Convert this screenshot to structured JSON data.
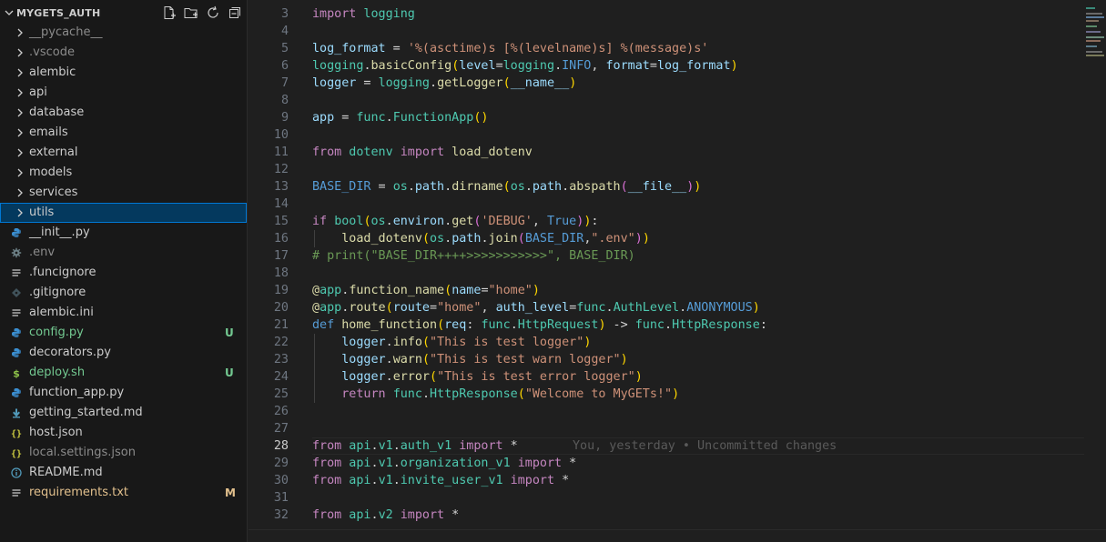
{
  "explorer": {
    "root_title": "MYGETS_AUTH",
    "header_icons": [
      "new-file-icon",
      "new-folder-icon",
      "refresh-icon",
      "collapse-all-icon"
    ],
    "folders": [
      {
        "label": "__pycache__",
        "dim": true
      },
      {
        "label": ".vscode",
        "dim": true
      },
      {
        "label": "alembic"
      },
      {
        "label": "api"
      },
      {
        "label": "database"
      },
      {
        "label": "emails"
      },
      {
        "label": "external"
      },
      {
        "label": "models"
      },
      {
        "label": "services"
      },
      {
        "label": "utils",
        "selected": true
      }
    ],
    "files": [
      {
        "label": "__init__.py",
        "icon": "python-icon"
      },
      {
        "label": ".env",
        "icon": "gear-icon",
        "dim": true
      },
      {
        "label": ".funcignore",
        "icon": "lines-icon"
      },
      {
        "label": ".gitignore",
        "icon": "git-icon"
      },
      {
        "label": "alembic.ini",
        "icon": "lines-icon"
      },
      {
        "label": "config.py",
        "icon": "python-icon",
        "status": "U"
      },
      {
        "label": "decorators.py",
        "icon": "python-icon"
      },
      {
        "label": "deploy.sh",
        "icon": "shell-icon",
        "status": "U"
      },
      {
        "label": "function_app.py",
        "icon": "python-icon"
      },
      {
        "label": "getting_started.md",
        "icon": "markdown-icon"
      },
      {
        "label": "host.json",
        "icon": "json-icon"
      },
      {
        "label": "local.settings.json",
        "icon": "json-icon",
        "dim": true
      },
      {
        "label": "README.md",
        "icon": "info-icon"
      },
      {
        "label": "requirements.txt",
        "icon": "lines-icon",
        "status": "M"
      }
    ]
  },
  "editor": {
    "active_line": "28",
    "blame": "You, yesterday • Uncommitted changes",
    "lines": [
      {
        "n": "3",
        "tokens": [
          [
            "k",
            "import"
          ],
          [
            "",
            ""
          ],
          [
            "t",
            " logging"
          ]
        ]
      },
      {
        "n": "4",
        "tokens": []
      },
      {
        "n": "5",
        "tokens": [
          [
            "v",
            "log_format"
          ],
          [
            "d",
            " = "
          ],
          [
            "s",
            "'%(asctime)s [%(levelname)s] %(message)s'"
          ]
        ]
      },
      {
        "n": "6",
        "tokens": [
          [
            "t",
            "logging"
          ],
          [
            "d",
            "."
          ],
          [
            "f",
            "basicConfig"
          ],
          [
            "y",
            "("
          ],
          [
            "v",
            "level"
          ],
          [
            "d",
            "="
          ],
          [
            "t",
            "logging"
          ],
          [
            "d",
            "."
          ],
          [
            "kw",
            "INFO"
          ],
          [
            "d",
            ", "
          ],
          [
            "v",
            "format"
          ],
          [
            "d",
            "="
          ],
          [
            "v",
            "log_format"
          ],
          [
            "y",
            ")"
          ]
        ]
      },
      {
        "n": "7",
        "tokens": [
          [
            "v",
            "logger"
          ],
          [
            "d",
            " = "
          ],
          [
            "t",
            "logging"
          ],
          [
            "d",
            "."
          ],
          [
            "f",
            "getLogger"
          ],
          [
            "y",
            "("
          ],
          [
            "v",
            "__name__"
          ],
          [
            "y",
            ")"
          ]
        ]
      },
      {
        "n": "8",
        "tokens": []
      },
      {
        "n": "9",
        "tokens": [
          [
            "v",
            "app"
          ],
          [
            "d",
            " = "
          ],
          [
            "t",
            "func"
          ],
          [
            "d",
            "."
          ],
          [
            "t",
            "FunctionApp"
          ],
          [
            "y",
            "()"
          ]
        ]
      },
      {
        "n": "10",
        "tokens": []
      },
      {
        "n": "11",
        "tokens": [
          [
            "k",
            "from"
          ],
          [
            "t",
            " dotenv"
          ],
          [
            "k",
            " import"
          ],
          [
            "f",
            " load_dotenv"
          ]
        ]
      },
      {
        "n": "12",
        "tokens": []
      },
      {
        "n": "13",
        "tokens": [
          [
            "kw",
            "BASE_DIR"
          ],
          [
            "d",
            " = "
          ],
          [
            "t",
            "os"
          ],
          [
            "d",
            "."
          ],
          [
            "v",
            "path"
          ],
          [
            "d",
            "."
          ],
          [
            "f",
            "dirname"
          ],
          [
            "y",
            "("
          ],
          [
            "t",
            "os"
          ],
          [
            "d",
            "."
          ],
          [
            "v",
            "path"
          ],
          [
            "d",
            "."
          ],
          [
            "f",
            "abspath"
          ],
          [
            "p",
            "("
          ],
          [
            "v",
            "__file__"
          ],
          [
            "p",
            ")"
          ],
          [
            "y",
            ")"
          ]
        ]
      },
      {
        "n": "14",
        "tokens": []
      },
      {
        "n": "15",
        "tokens": [
          [
            "k",
            "if"
          ],
          [
            "d",
            " "
          ],
          [
            "t",
            "bool"
          ],
          [
            "y",
            "("
          ],
          [
            "t",
            "os"
          ],
          [
            "d",
            "."
          ],
          [
            "v",
            "environ"
          ],
          [
            "d",
            "."
          ],
          [
            "f",
            "get"
          ],
          [
            "p",
            "("
          ],
          [
            "s",
            "'DEBUG'"
          ],
          [
            "d",
            ", "
          ],
          [
            "kw",
            "True"
          ],
          [
            "p",
            ")"
          ],
          [
            "y",
            ")"
          ],
          [
            "d",
            ":"
          ]
        ]
      },
      {
        "n": "16",
        "tokens": [
          [
            "d",
            "    "
          ],
          [
            "f",
            "load_dotenv"
          ],
          [
            "y",
            "("
          ],
          [
            "t",
            "os"
          ],
          [
            "d",
            "."
          ],
          [
            "v",
            "path"
          ],
          [
            "d",
            "."
          ],
          [
            "f",
            "join"
          ],
          [
            "p",
            "("
          ],
          [
            "kw",
            "BASE_DIR"
          ],
          [
            "d",
            ","
          ],
          [
            "s",
            "\".env\""
          ],
          [
            "p",
            ")"
          ],
          [
            "y",
            ")"
          ]
        ]
      },
      {
        "n": "17",
        "tokens": [
          [
            "c",
            "# print(\"BASE_DIR++++>>>>>>>>>>>\", BASE_DIR)"
          ]
        ]
      },
      {
        "n": "18",
        "tokens": []
      },
      {
        "n": "19",
        "tokens": [
          [
            "f",
            "@"
          ],
          [
            "t",
            "app"
          ],
          [
            "d",
            "."
          ],
          [
            "f",
            "function_name"
          ],
          [
            "y",
            "("
          ],
          [
            "v",
            "name"
          ],
          [
            "d",
            "="
          ],
          [
            "s",
            "\"home\""
          ],
          [
            "y",
            ")"
          ]
        ]
      },
      {
        "n": "20",
        "tokens": [
          [
            "f",
            "@"
          ],
          [
            "t",
            "app"
          ],
          [
            "d",
            "."
          ],
          [
            "f",
            "route"
          ],
          [
            "y",
            "("
          ],
          [
            "v",
            "route"
          ],
          [
            "d",
            "="
          ],
          [
            "s",
            "\"home\""
          ],
          [
            "d",
            ", "
          ],
          [
            "v",
            "auth_level"
          ],
          [
            "d",
            "="
          ],
          [
            "t",
            "func"
          ],
          [
            "d",
            "."
          ],
          [
            "t",
            "AuthLevel"
          ],
          [
            "d",
            "."
          ],
          [
            "kw",
            "ANONYMOUS"
          ],
          [
            "y",
            ")"
          ]
        ]
      },
      {
        "n": "21",
        "tokens": [
          [
            "kw",
            "def"
          ],
          [
            "f",
            " home_function"
          ],
          [
            "y",
            "("
          ],
          [
            "v",
            "req"
          ],
          [
            "d",
            ": "
          ],
          [
            "t",
            "func"
          ],
          [
            "d",
            "."
          ],
          [
            "t",
            "HttpRequest"
          ],
          [
            "y",
            ")"
          ],
          [
            "d",
            " -> "
          ],
          [
            "t",
            "func"
          ],
          [
            "d",
            "."
          ],
          [
            "t",
            "HttpResponse"
          ],
          [
            "d",
            ":"
          ]
        ]
      },
      {
        "n": "22",
        "tokens": [
          [
            "d",
            "    "
          ],
          [
            "v",
            "logger"
          ],
          [
            "d",
            "."
          ],
          [
            "f",
            "info"
          ],
          [
            "y",
            "("
          ],
          [
            "s",
            "\"This is test logger\""
          ],
          [
            "y",
            ")"
          ]
        ]
      },
      {
        "n": "23",
        "tokens": [
          [
            "d",
            "    "
          ],
          [
            "v",
            "logger"
          ],
          [
            "d",
            "."
          ],
          [
            "f",
            "warn"
          ],
          [
            "y",
            "("
          ],
          [
            "s",
            "\"This is test warn logger\""
          ],
          [
            "y",
            ")"
          ]
        ]
      },
      {
        "n": "24",
        "tokens": [
          [
            "d",
            "    "
          ],
          [
            "v",
            "logger"
          ],
          [
            "d",
            "."
          ],
          [
            "f",
            "error"
          ],
          [
            "y",
            "("
          ],
          [
            "s",
            "\"This is test error logger\""
          ],
          [
            "y",
            ")"
          ]
        ]
      },
      {
        "n": "25",
        "tokens": [
          [
            "d",
            "    "
          ],
          [
            "k",
            "return"
          ],
          [
            "d",
            " "
          ],
          [
            "t",
            "func"
          ],
          [
            "d",
            "."
          ],
          [
            "t",
            "HttpResponse"
          ],
          [
            "y",
            "("
          ],
          [
            "s",
            "\"Welcome to MyGETs!\""
          ],
          [
            "y",
            ")"
          ]
        ]
      },
      {
        "n": "26",
        "tokens": []
      },
      {
        "n": "27",
        "tokens": []
      },
      {
        "n": "28",
        "tokens": [
          [
            "k",
            "from"
          ],
          [
            "t",
            " api"
          ],
          [
            "d",
            "."
          ],
          [
            "t",
            "v1"
          ],
          [
            "d",
            "."
          ],
          [
            "t",
            "auth_v1"
          ],
          [
            "k",
            " import"
          ],
          [
            "d",
            " *"
          ]
        ]
      },
      {
        "n": "29",
        "tokens": [
          [
            "k",
            "from"
          ],
          [
            "t",
            " api"
          ],
          [
            "d",
            "."
          ],
          [
            "t",
            "v1"
          ],
          [
            "d",
            "."
          ],
          [
            "t",
            "organization_v1"
          ],
          [
            "k",
            " import"
          ],
          [
            "d",
            " *"
          ]
        ]
      },
      {
        "n": "30",
        "tokens": [
          [
            "k",
            "from"
          ],
          [
            "t",
            " api"
          ],
          [
            "d",
            "."
          ],
          [
            "t",
            "v1"
          ],
          [
            "d",
            "."
          ],
          [
            "t",
            "invite_user_v1"
          ],
          [
            "k",
            " import"
          ],
          [
            "d",
            " *"
          ]
        ]
      },
      {
        "n": "31",
        "tokens": []
      },
      {
        "n": "32",
        "tokens": [
          [
            "k",
            "from"
          ],
          [
            "t",
            " api"
          ],
          [
            "d",
            "."
          ],
          [
            "t",
            "v2"
          ],
          [
            "k",
            " import"
          ],
          [
            "d",
            " *"
          ]
        ]
      }
    ]
  },
  "colors": {
    "sidebar_bg": "#181818",
    "editor_bg": "#1f1f1f",
    "selection": "#04395e",
    "untracked": "#73c991",
    "modified": "#e2c08d"
  }
}
